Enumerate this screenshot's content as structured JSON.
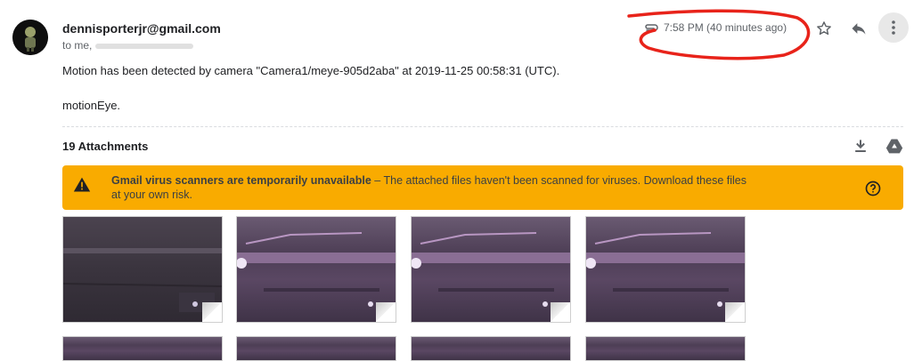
{
  "sender": {
    "email": "dennisporterjr@gmail.com",
    "recipients_prefix": "to me,"
  },
  "meta": {
    "time": "7:58 PM (40 minutes ago)"
  },
  "body": {
    "line1": "Motion has been detected by camera \"Camera1/meye-905d2aba\" at 2019-11-25 00:58:31 (UTC).",
    "line2": "motionEye."
  },
  "attachments": {
    "title": "19 Attachments"
  },
  "warning": {
    "bold": "Gmail virus scanners are temporarily unavailable",
    "text": " – The attached files haven't been scanned for viruses. Download these files at your own risk."
  },
  "colors": {
    "warning_bg": "#f9ab00",
    "annotation_red": "#e8231a"
  },
  "icons": [
    "attachment-icon",
    "star-icon",
    "reply-icon",
    "more-vert-icon",
    "download-icon",
    "drive-icon",
    "warning-icon",
    "help-icon"
  ]
}
